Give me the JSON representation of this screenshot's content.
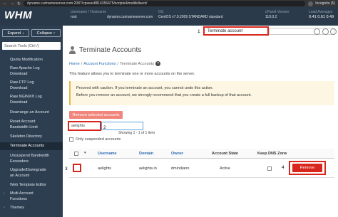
{
  "browser": {
    "url": "dynamo.curinameserver.com:2087/cpsess8814356475/scripts4/multikillacct/",
    "mode": "Incognito (5)"
  },
  "header": {
    "logo": "WHM",
    "username_label": "Username / Hostname",
    "username_value": "root",
    "hostname_value": "dynamo.curinameserver.com",
    "os_label": "OS",
    "os_value": "CentOS v7.9.2009 STANDARD standard",
    "version_label": "cPanel Version",
    "version_value": "110.0.2",
    "load_label": "Load Averages",
    "load_values": "0.41  0.61  0.49"
  },
  "sidebar": {
    "expand": "Expand",
    "collapse": "Collapse",
    "search_placeholder": "Search Tools (Ctrl /)",
    "items": [
      {
        "label": "Quota Modification"
      },
      {
        "label": "Raw Apache Log"
      },
      {
        "label": "Download"
      },
      {
        "label": "Raw FTP Log"
      },
      {
        "label": "Download"
      },
      {
        "label": "Raw NGINX® Log"
      },
      {
        "label": "Download"
      },
      {
        "label": "Rearrange an Account"
      },
      {
        "label": "Reset Account"
      },
      {
        "label": "Bandwidth Limit"
      },
      {
        "label": "Skeleton Directory"
      },
      {
        "label": "Terminate Accounts"
      },
      {
        "label": "Unsuspend Bandwidth"
      },
      {
        "label": "Exceeders"
      },
      {
        "label": "Upgrade/Downgrade"
      },
      {
        "label": "an Account"
      },
      {
        "label": "Web Template Editor"
      },
      {
        "label": "Multi Account"
      },
      {
        "label": "Functions"
      },
      {
        "label": "Themes"
      }
    ]
  },
  "search_top": {
    "value": "Terminate account"
  },
  "annotations": {
    "n1": "1",
    "n2": "2",
    "n3": "3",
    "n4": "4"
  },
  "page": {
    "title": "Terminate Accounts",
    "breadcrumb_home": "Home",
    "breadcrumb_sep": "/",
    "breadcrumb_section": "Account Functions",
    "breadcrumb_current": "Terminate Accounts",
    "description": "This feature allows you to terminate one or more accounts on the server.",
    "warning_line1": "Proceed with caution. If you terminate an account, you cannot undo this action.",
    "warning_line2": "Before you remove an account, we strongly recommend that you create a full backup of that account.",
    "remove_selected": "Remove selected accounts",
    "filter_value": "aelights",
    "showing": "Showing 1 - 1 of 1 item",
    "only_suspended": "Only suspended accounts"
  },
  "table": {
    "headers": {
      "username": "Username",
      "domain": "Domain",
      "owner": "Owner",
      "state": "Account State",
      "keep_dns": "Keep DNS Zone"
    },
    "rows": [
      {
        "username": "aelights",
        "domain": "aelights.in",
        "owner": "dmindiann",
        "state": "Active",
        "action": "Remove"
      }
    ]
  }
}
